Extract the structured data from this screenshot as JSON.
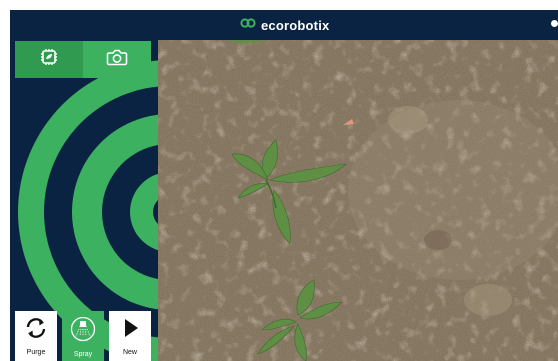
{
  "header": {
    "brand": "ecorobotix",
    "logo_icon": "ecorobotix-logo-icon",
    "status_icon": "status-dot-icon"
  },
  "mode_bar": {
    "buttons": [
      {
        "icon": "chip-icon",
        "active": true
      },
      {
        "icon": "camera-icon",
        "active": false
      }
    ]
  },
  "actions": [
    {
      "label": "Purge",
      "icon": "refresh-icon"
    },
    {
      "label": "Spray",
      "icon": "spray-nozzle-icon"
    },
    {
      "label": "New",
      "icon": "play-icon"
    }
  ],
  "colors": {
    "navy": "#0b2342",
    "green": "#3cb15f",
    "soil": "#8c7c66"
  }
}
